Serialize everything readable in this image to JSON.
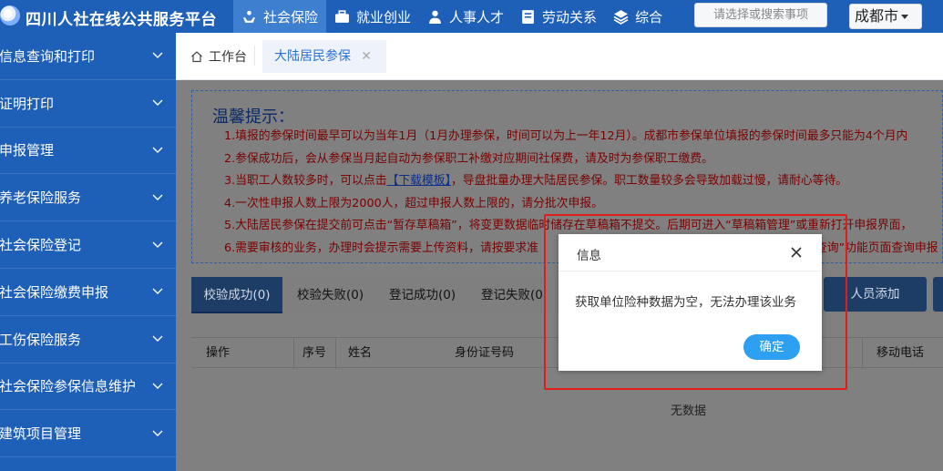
{
  "header": {
    "site_title": "四川人社在线公共服务平台",
    "nav": [
      {
        "label": "社会保险",
        "icon": "social-insurance-icon",
        "active": true
      },
      {
        "label": "就业创业",
        "icon": "briefcase-icon",
        "active": false
      },
      {
        "label": "人事人才",
        "icon": "person-icon",
        "active": false
      },
      {
        "label": "劳动关系",
        "icon": "document-icon",
        "active": false
      },
      {
        "label": "综合",
        "icon": "layers-icon",
        "active": false
      }
    ],
    "search_placeholder": "请选择或搜索事项",
    "city": "成都市"
  },
  "sidebar": {
    "items": [
      {
        "label": "信息查询和打印"
      },
      {
        "label": "证明打印"
      },
      {
        "label": "申报管理"
      },
      {
        "label": "养老保险服务"
      },
      {
        "label": "社会保险登记"
      },
      {
        "label": "社会保险缴费申报"
      },
      {
        "label": "工伤保险服务"
      },
      {
        "label": "社会保险参保信息维护"
      },
      {
        "label": "建筑项目管理"
      }
    ]
  },
  "tabs": {
    "home": "工作台",
    "active": "大陆居民参保"
  },
  "notice": {
    "title": "温馨提示：",
    "lines": [
      "1.填报的参保时间最早可以为当年1月（1月办理参保，时间可以为上一年12月）。成都市参保单位填报的参保时间最多只能为4个月内",
      "2.参保成功后，会从参保当月起自动为参保职工补缴对应期间社保费，请及时为参保职工缴费。",
      "3.当职工人数较多时，可以点击",
      "4.一次性申报人数上限为2000人，超过申报人数上限的，请分批次申报。",
      "5.大陆居民参保在提交前可点击“暂存草稿箱”，将变更数据临时储存在草稿箱不提交。后期可进入“草稿箱管理”或重新打开申报界面，",
      "6.需要审核的业务，办理时会提示需要上传资料，请按要求准"
    ],
    "line3_link": "【下载模板】",
    "line3_rest": "，导盘批量办理大陆居民参保。职工数量较多会导致加载过慢，请耐心等待。",
    "line6_tail": "查询”功能页面查询申报"
  },
  "subtabs": [
    "校验成功(0)",
    "校验失败(0)",
    "登记成功(0)",
    "登记失败(0"
  ],
  "add_button": "人员添加",
  "table": {
    "columns": [
      "操作",
      "序号",
      "姓名",
      "身份证号码",
      "移动电话"
    ],
    "empty_text": "无数据"
  },
  "modal": {
    "title": "信息",
    "message": "获取单位险种数据为空，无法办理该业务",
    "ok_label": "确定"
  },
  "colors": {
    "brand_blue": "#1e5fb8",
    "notice_text": "#7a0000",
    "highlight_red": "#e21b1b",
    "ok_button": "#2ea0f2"
  }
}
